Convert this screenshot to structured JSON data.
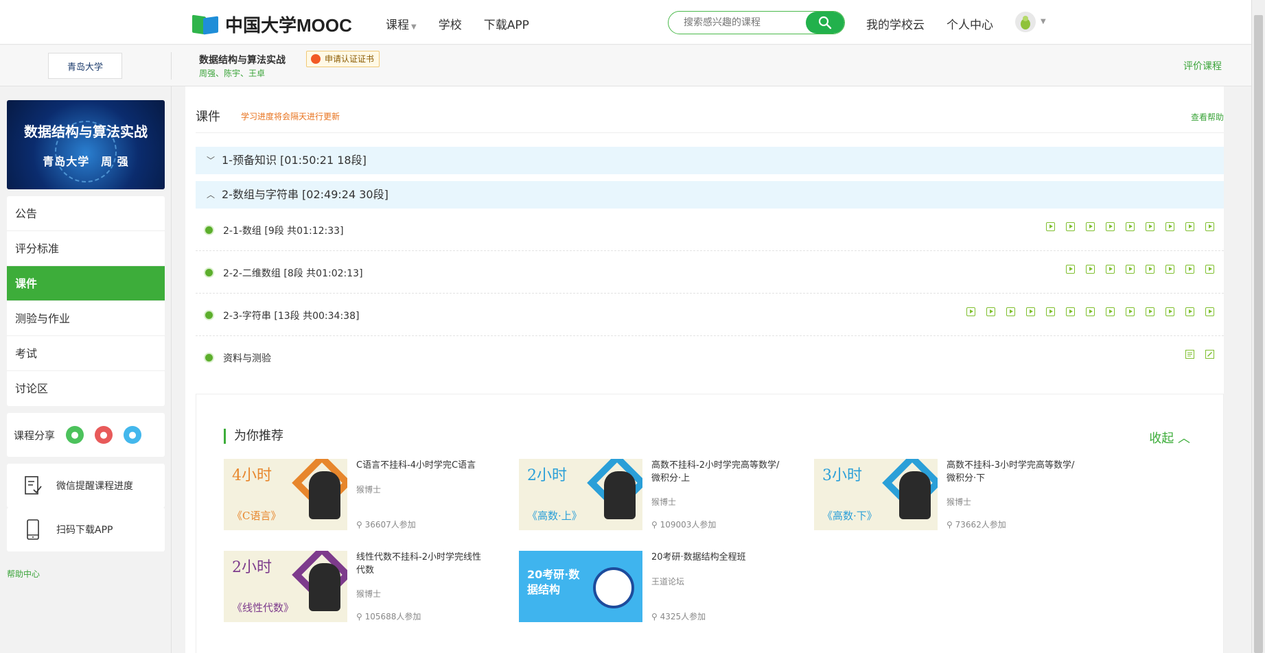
{
  "topbar": {
    "logo_text": "中国大学MOOC",
    "nav": [
      "课程",
      "学校",
      "下载APP"
    ],
    "search_placeholder": "搜索感兴趣的课程",
    "links": [
      "我的学校云",
      "个人中心"
    ]
  },
  "course": {
    "school_logo_text": "青岛大学",
    "title": "数据结构与算法实战",
    "teachers": "周强、陈宇、王卓",
    "cert_label": "申请认证证书",
    "rate_label": "评价课程"
  },
  "sidebar": {
    "cover_title": "数据结构与算法实战",
    "cover_sub": "青岛大学　周 强",
    "menu": [
      "公告",
      "评分标准",
      "课件",
      "测验与作业",
      "考试",
      "讨论区"
    ],
    "active_index": 2,
    "share_label": "课程分享",
    "wechat_remind": "微信提醒课程进度",
    "scan_download": "扫码下载APP",
    "help_center": "帮助中心"
  },
  "main": {
    "title": "课件",
    "note": "学习进度将会隔天进行更新",
    "help": "查看帮助",
    "chapters": [
      {
        "label": "1-预备知识 [01:50:21 18段]",
        "expanded": false
      },
      {
        "label": "2-数组与字符串 [02:49:24 30段]",
        "expanded": true
      }
    ],
    "lessons": [
      {
        "label": "2-1-数组 [9段 共01:12:33]",
        "video_count": 9
      },
      {
        "label": "2-2-二维数组 [8段 共01:02:13]",
        "video_count": 8
      },
      {
        "label": "2-3-字符串 [13段 共00:34:38]",
        "video_count": 13
      },
      {
        "label": "资料与测验",
        "video_count": 0
      }
    ]
  },
  "recommend": {
    "title": "为你推荐",
    "fold": "收起",
    "cards": [
      {
        "title": "C语言不挂科-4小时学完C语言",
        "author": "猴博士",
        "people": "36607人参加",
        "thumb_big": "4小时",
        "thumb_sub": "《C语言》",
        "color": "#e7862c"
      },
      {
        "title": "高数不挂科-2小时学完高等数学/微积分·上",
        "author": "猴博士",
        "people": "109003人参加",
        "thumb_big": "2小时",
        "thumb_sub": "《高数·上》",
        "color": "#2a9fd8"
      },
      {
        "title": "高数不挂科-3小时学完高等数学/微积分·下",
        "author": "猴博士",
        "people": "73662人参加",
        "thumb_big": "3小时",
        "thumb_sub": "《高数·下》",
        "color": "#2a9fd8"
      },
      {
        "title": "线性代数不挂科-2小时学完线性代数",
        "author": "猴博士",
        "people": "105688人参加",
        "thumb_big": "2小时",
        "thumb_sub": "《线性代数》",
        "color": "#7d3b8c"
      },
      {
        "title": "20考研·数据结构全程班",
        "author": "王道论坛",
        "people": "4325人参加",
        "thumb_big": "20考研·数据结构",
        "thumb_sub": "",
        "color": "#3fb4ee"
      }
    ]
  },
  "colors": {
    "accent": "#3dad3a",
    "chapter_bg": "#e8f6fd",
    "note": "#e8731e"
  }
}
